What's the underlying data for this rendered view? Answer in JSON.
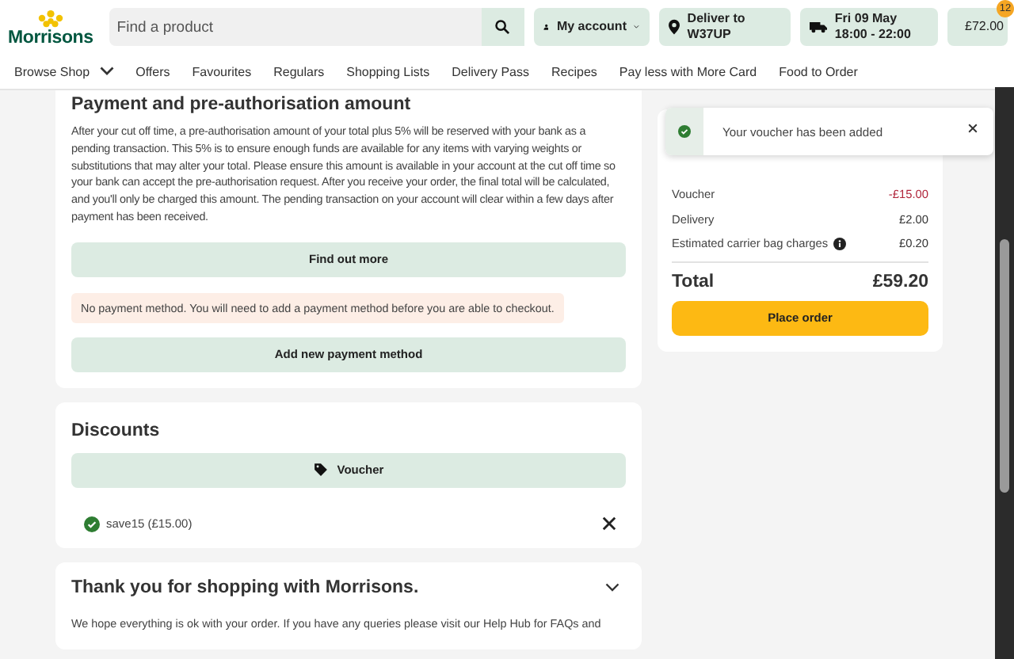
{
  "header": {
    "logo": "Morrisons",
    "search": {
      "placeholder": "Find a product"
    },
    "account": "My account",
    "delivery": {
      "line1": "Deliver to",
      "line2": "W37UP"
    },
    "slot": {
      "line1": "Fri 09 May",
      "line2": "18:00 - 22:00"
    },
    "basket": {
      "total": "£72.00",
      "count": "12"
    }
  },
  "nav": [
    {
      "label": "Browse Shop",
      "dropdown": true
    },
    {
      "label": "Offers",
      "dropdown": false
    },
    {
      "label": "Favourites",
      "dropdown": false
    },
    {
      "label": "Regulars",
      "dropdown": false
    },
    {
      "label": "Shopping Lists",
      "dropdown": false
    },
    {
      "label": "Delivery Pass",
      "dropdown": false
    },
    {
      "label": "Recipes",
      "dropdown": false
    },
    {
      "label": "Pay less with More Card",
      "dropdown": false
    },
    {
      "label": "Food to Order",
      "dropdown": false
    }
  ],
  "payment": {
    "title": "Payment and pre-authorisation amount",
    "text": "After your cut off time, a pre-authorisation amount of your total plus 5% will be reserved with your bank as a pending transaction. This 5% is to ensure enough funds are available for any items with varying weights or substitutions that may alter your total. Please ensure this amount is available in your account at the cut off time so your bank can accept the pre-authorisation request. After you receive your order, the final total will be calculated, and you'll only be charged this amount. The pending transaction on your account will clear within a few days after payment has been received.",
    "find_out_more": "Find out more",
    "warning": "No payment method. You will need to add a payment method before you are able to checkout.",
    "add_button": "Add new payment method"
  },
  "discounts": {
    "title": "Discounts",
    "voucher_button": "Voucher",
    "applied": [
      {
        "label": "save15 (£15.00)"
      }
    ]
  },
  "toast": {
    "message": "Your voucher has been added"
  },
  "summary": {
    "rows": [
      {
        "label": "Voucher",
        "value": "-£15.00",
        "kind": "discount",
        "info": false
      },
      {
        "label": "Delivery",
        "value": "£2.00",
        "kind": "normal",
        "info": false
      },
      {
        "label": "Estimated carrier bag charges",
        "value": "£0.20",
        "kind": "normal",
        "info": true
      }
    ],
    "total_label": "Total",
    "total_value": "£59.20",
    "button": "Place order"
  },
  "thanks": {
    "title": "Thank you for shopping with Morrisons.",
    "expanded": false,
    "text": "We hope everything is ok with your order. If you have any queries please visit our Help Hub for FAQs and"
  }
}
